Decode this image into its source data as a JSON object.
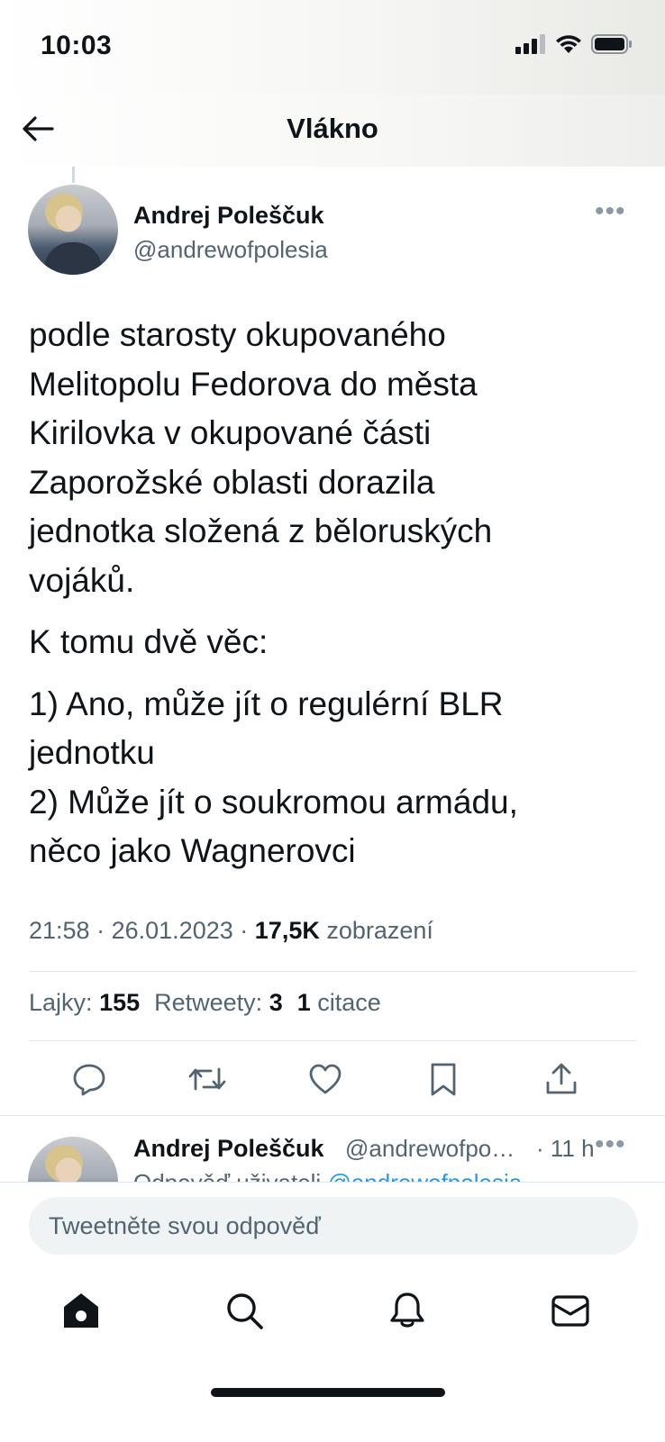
{
  "status_bar": {
    "time": "10:03"
  },
  "header": {
    "title": "Vlákno"
  },
  "tweet": {
    "author_name": "Andrej Poleščuk",
    "author_handle": "@andrewofpolesia",
    "paragraphs": [
      "podle starosty okupovaného\nMelitopolu Fedorova do města\nKirilovka v okupované části\nZaporožské oblasti dorazila\njednotka složená z běloruských\nvojáků.",
      "K tomu dvě věc:",
      "1) Ano, může jít o regulérní BLR\njednotku\n2) Může jít o soukromou armádu,\nněco jako Wagnerovci"
    ],
    "time": "21:58",
    "date": "26.01.2023",
    "views_count": "17,5K",
    "views_label": "zobrazení",
    "separator": "·",
    "likes_label": "Lajky:",
    "likes_count": "155",
    "retweets_label": "Retweety:",
    "retweets_count": "3",
    "quotes_count": "1",
    "quotes_label": "citace"
  },
  "actions": [
    {
      "name": "reply-icon"
    },
    {
      "name": "retweet-icon"
    },
    {
      "name": "like-icon"
    },
    {
      "name": "bookmark-icon"
    },
    {
      "name": "share-icon"
    }
  ],
  "reply": {
    "author_name": "Andrej Poleščuk",
    "author_handle": "@andrewofpo…",
    "time": "· 11 h",
    "context_prefix": "Odpověď uživateli",
    "context_link": "@andrewofpolesia"
  },
  "composer": {
    "placeholder": "Tweetněte svou odpověď"
  },
  "tabbar": [
    {
      "name": "home-icon"
    },
    {
      "name": "search-icon"
    },
    {
      "name": "notifications-icon"
    },
    {
      "name": "messages-icon"
    }
  ],
  "colors": {
    "accent": "#1d9bf0",
    "text": "#0f1419",
    "secondary": "#536471"
  }
}
